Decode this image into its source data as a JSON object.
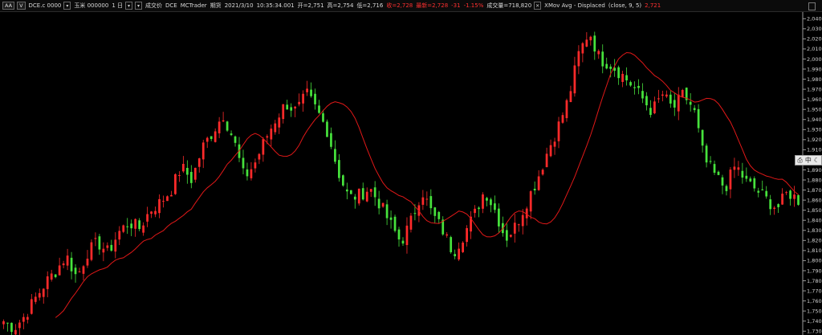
{
  "toolbar": {
    "btn_aa": "AA",
    "btn_v": "V",
    "symbol": "DCE.c 0000",
    "product": "玉米 000000",
    "interval": "1 日",
    "price_field": "成交价",
    "exchange": "DCE",
    "platform": "MCTrader",
    "mode": "期货",
    "datetime": "2021/3/10",
    "time": "10:35:34.001",
    "open": "开=2,751",
    "high": "高=2,754",
    "low": "低=2,716",
    "close": "收=2,728",
    "last": "最新=2,728",
    "change": "-31",
    "change_pct": "-1.15%",
    "volume": "成交量=718,820",
    "indicator": "XMov Avg - Displaced",
    "indicator_params": "(close, 9, 5)",
    "indicator_value": "2,721"
  },
  "tool": {
    "lang": "中",
    "moon_icon": "moon-icon"
  },
  "colors": {
    "up": "#ff2a2a",
    "down": "#46e23c",
    "ma": "#e01818",
    "bg": "#000000"
  },
  "chart_data": {
    "type": "candlestick",
    "y_ticks": [
      1730,
      1740,
      1750,
      1760,
      1770,
      1780,
      1790,
      1800,
      1810,
      1820,
      1830,
      1840,
      1850,
      1860,
      1870,
      1880,
      1890,
      1900,
      1910,
      1920,
      1930,
      1940,
      1950,
      1960,
      1970,
      1980,
      1990,
      2000,
      2010,
      2020,
      2030,
      2040
    ],
    "ylim": [
      1727,
      2045
    ],
    "y_axis_position": "right",
    "moving_average": {
      "name": "XMov Avg - Displaced",
      "length": 9,
      "displace": 5
    },
    "close_path": [
      1740,
      1733,
      1745,
      1762,
      1778,
      1790,
      1805,
      1783,
      1808,
      1818,
      1808,
      1828,
      1838,
      1832,
      1850,
      1858,
      1870,
      1893,
      1880,
      1912,
      1928,
      1945,
      1920,
      1882,
      1896,
      1920,
      1940,
      1956,
      1948,
      1965,
      1948,
      1928,
      1888,
      1862,
      1865,
      1872,
      1856,
      1836,
      1818,
      1840,
      1870,
      1846,
      1830,
      1808,
      1826,
      1845,
      1870,
      1850,
      1822,
      1835,
      1858,
      1880,
      1908,
      1932,
      1960,
      2005,
      2028,
      2000,
      1995,
      1986,
      1975,
      1962,
      1948,
      1965,
      1950,
      1965,
      1950,
      1900,
      1885,
      1872,
      1895,
      1878,
      1870,
      1860,
      1852,
      1868,
      1860
    ],
    "close_steps": 200
  }
}
